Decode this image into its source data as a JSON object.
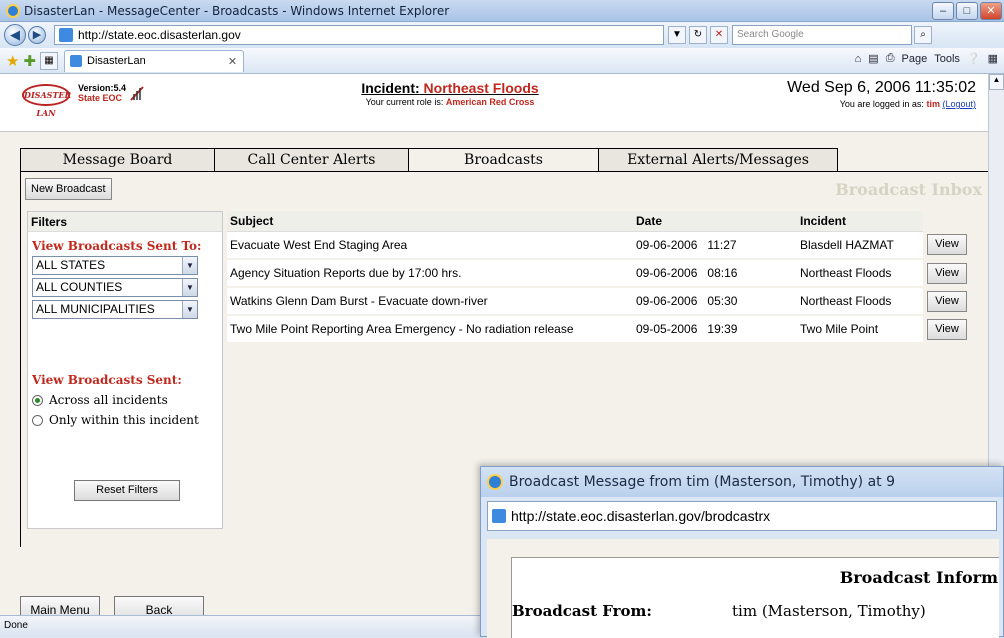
{
  "window": {
    "title": "DisasterLan - MessageCenter - Broadcasts - Windows Internet Explorer",
    "url": "http://state.eoc.disasterlan.gov",
    "search_placeholder": "Search Google",
    "tab_label": "DisasterLan",
    "commands": [
      "Page",
      "Tools"
    ],
    "status": "Done"
  },
  "header": {
    "logo_text": "DISASTER LAN",
    "version": "Version:5.4",
    "role_site": "State EOC",
    "incident_label": "Incident:",
    "incident_name": "Northeast Floods",
    "role_prefix": "Your current role is:",
    "role": "American Red Cross",
    "datetime": "Wed Sep 6, 2006 11:35:02",
    "login_prefix": "You are logged in as:",
    "user": "tim",
    "logout": "(Logout)"
  },
  "nav_tabs": [
    "Message Board",
    "Call Center Alerts",
    "Broadcasts",
    "External Alerts/Messages"
  ],
  "active_tab": "Broadcasts",
  "toolbar": {
    "new_broadcast": "New Broadcast",
    "inbox_title": "Broadcast Inbox"
  },
  "filters": {
    "header": "Filters",
    "sent_to_title": "View Broadcasts Sent To:",
    "states": "ALL STATES",
    "counties": "ALL COUNTIES",
    "municipalities": "ALL MUNICIPALITIES",
    "sent_title": "View Broadcasts Sent:",
    "option_all": "Across all incidents",
    "option_this": "Only within this incident",
    "reset": "Reset Filters"
  },
  "table": {
    "headers": [
      "Subject",
      "Date",
      "Incident"
    ],
    "view_label": "View",
    "rows": [
      {
        "subject": "Evacuate West End Staging Area",
        "date": "09-06-2006",
        "time": "11:27",
        "incident": "Blasdell HAZMAT"
      },
      {
        "subject": "Agency Situation Reports due by 17:00 hrs.",
        "date": "09-06-2006",
        "time": "08:16",
        "incident": "Northeast Floods"
      },
      {
        "subject": "Watkins Glenn Dam Burst - Evacuate down-river",
        "date": "09-06-2006",
        "time": "05:30",
        "incident": "Northeast Floods"
      },
      {
        "subject": "Two Mile Point Reporting Area Emergency - No radiation release",
        "date": "09-05-2006",
        "time": "19:39",
        "incident": "Two Mile Point"
      }
    ]
  },
  "bottom": {
    "main_menu": "Main Menu",
    "back": "Back"
  },
  "popup": {
    "title": "Broadcast Message from tim (Masterson, Timothy) at 9",
    "url": "http://state.eoc.disasterlan.gov/brodcastrx",
    "heading": "Broadcast Inform",
    "from_label": "Broadcast From:",
    "from_value": "tim (Masterson, Timothy)"
  }
}
